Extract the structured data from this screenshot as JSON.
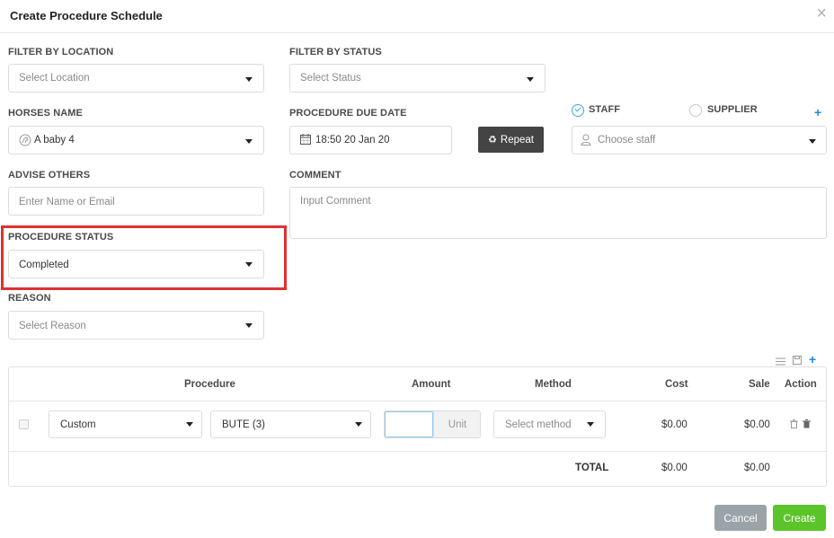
{
  "modal": {
    "title": "Create Procedure Schedule",
    "close": "×"
  },
  "filter_location": {
    "label": "FILTER BY LOCATION",
    "placeholder": "Select Location"
  },
  "filter_status": {
    "label": "FILTER BY STATUS",
    "placeholder": "Select Status"
  },
  "horses": {
    "label": "HORSES NAME",
    "value": "A baby 4"
  },
  "due_date": {
    "label": "PROCEDURE DUE DATE",
    "value": "18:50 20 Jan 20"
  },
  "repeat_button": {
    "label": "Repeat"
  },
  "assignee": {
    "staff_label": "STAFF",
    "supplier_label": "SUPPLIER",
    "selected": "STAFF",
    "placeholder": "Choose staff"
  },
  "advise": {
    "label": "ADVISE OTHERS",
    "placeholder": "Enter Name or Email"
  },
  "comment": {
    "label": "COMMENT",
    "placeholder": "Input Comment"
  },
  "status": {
    "label": "PROCEDURE STATUS",
    "value": "Completed"
  },
  "reason": {
    "label": "REASON",
    "placeholder": "Select Reason"
  },
  "table": {
    "headers": {
      "procedure": "Procedure",
      "amount": "Amount",
      "method": "Method",
      "cost": "Cost",
      "sale": "Sale",
      "action": "Action"
    },
    "rows": [
      {
        "type": "Custom",
        "procedure": "BUTE (3)",
        "amount": "",
        "unit": "Unit",
        "method_placeholder": "Select method",
        "cost": "$0.00",
        "sale": "$0.00"
      }
    ],
    "total": {
      "label": "TOTAL",
      "cost": "$0.00",
      "sale": "$0.00"
    }
  },
  "footer": {
    "cancel": "Cancel",
    "create": "Create"
  },
  "colors": {
    "accent": "#1e88e5",
    "create": "#5bc42b",
    "cancel": "#9aa3a8",
    "highlight": "#e03131",
    "dark_button": "#444444"
  }
}
